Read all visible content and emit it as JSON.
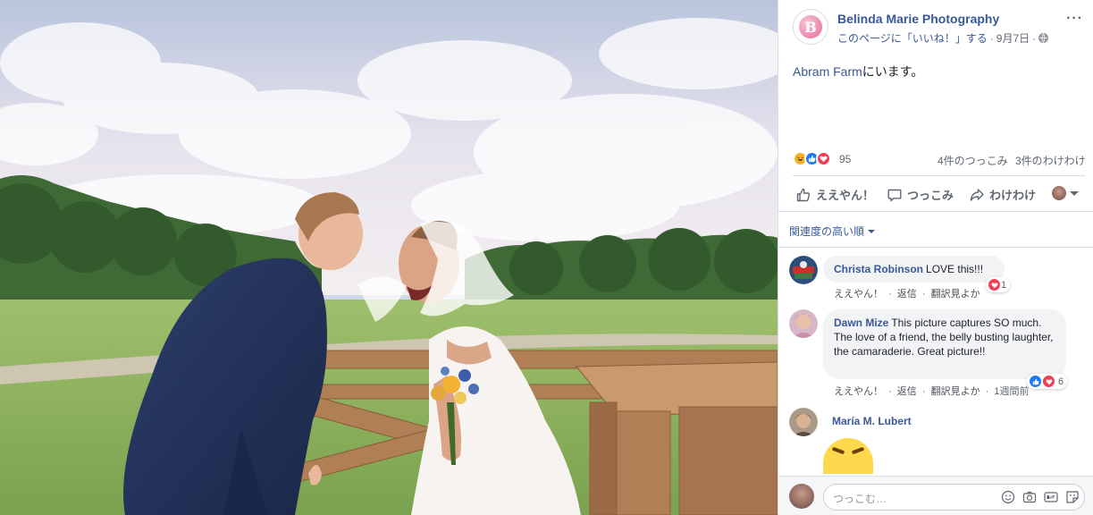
{
  "post": {
    "page_name": "Belinda Marie Photography",
    "page_avatar_letter": "B",
    "like_page_text": "このページに「いいね！」する",
    "separator": "·",
    "date": "9月7日",
    "separator2": "·",
    "more_label": "···",
    "checkin_place": "Abram Farm",
    "checkin_suffix": "にいます。"
  },
  "stats": {
    "reactions_count": "95",
    "comments_text": "4件のつっこみ",
    "shares_text": "3件のわけわけ"
  },
  "actions": {
    "like_label": "ええやん！",
    "comment_label": "つっこみ",
    "share_label": "わけわけ"
  },
  "sort_label": "関連度の高い順",
  "comments": [
    {
      "author": "Christa Robinson",
      "text": "LOVE this!!!",
      "like_link": "ええやん！",
      "reply_link": "返信",
      "translate_link": "翻訳見よか",
      "time": "",
      "reaction_count": "1"
    },
    {
      "author": "Dawn Mize",
      "text": "This picture captures SO much. The love of a friend, the belly busting laughter, the camaraderie. Great picture!!",
      "like_link": "ええやん！",
      "reply_link": "返信",
      "translate_link": "翻訳見よか",
      "time": "1週間前",
      "reaction_count": "6"
    },
    {
      "author": "María M. Lubert"
    }
  ],
  "composer": {
    "placeholder": "つっこむ…"
  },
  "colors": {
    "link": "#385898",
    "like": "#2078f4",
    "love": "#f33e58",
    "haha": "#f7b125"
  }
}
